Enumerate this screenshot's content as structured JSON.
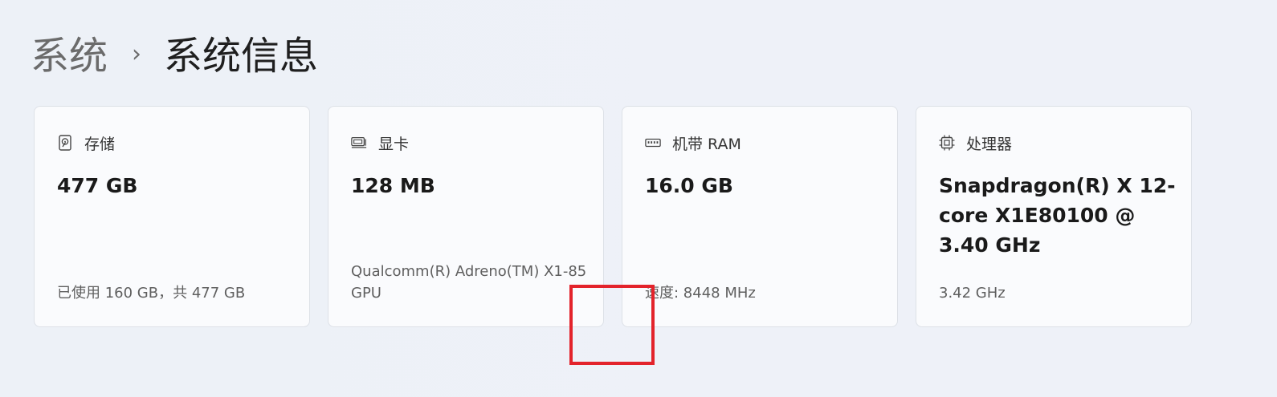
{
  "breadcrumb": {
    "parent": "系统",
    "separator": "›",
    "current": "系统信息"
  },
  "cards": [
    {
      "icon": "storage-icon",
      "title": "存储",
      "value": "477 GB",
      "detail": "已使用 160 GB，共 477 GB"
    },
    {
      "icon": "graphics-card-icon",
      "title": "显卡",
      "value": "128 MB",
      "detail": "Qualcomm(R) Adreno(TM) X1-85 GPU"
    },
    {
      "icon": "memory-icon",
      "title": "机带 RAM",
      "value": "16.0 GB",
      "detail": "速度: 8448 MHz"
    },
    {
      "icon": "processor-icon",
      "title": "处理器",
      "value": "Snapdragon(R) X 12-core X1E80100 @ 3.40 GHz",
      "detail": "3.42 GHz"
    }
  ],
  "colors": {
    "highlight": "#e3232b",
    "card_bg": "#fafbfd",
    "page_bg": "#eef1f7"
  }
}
